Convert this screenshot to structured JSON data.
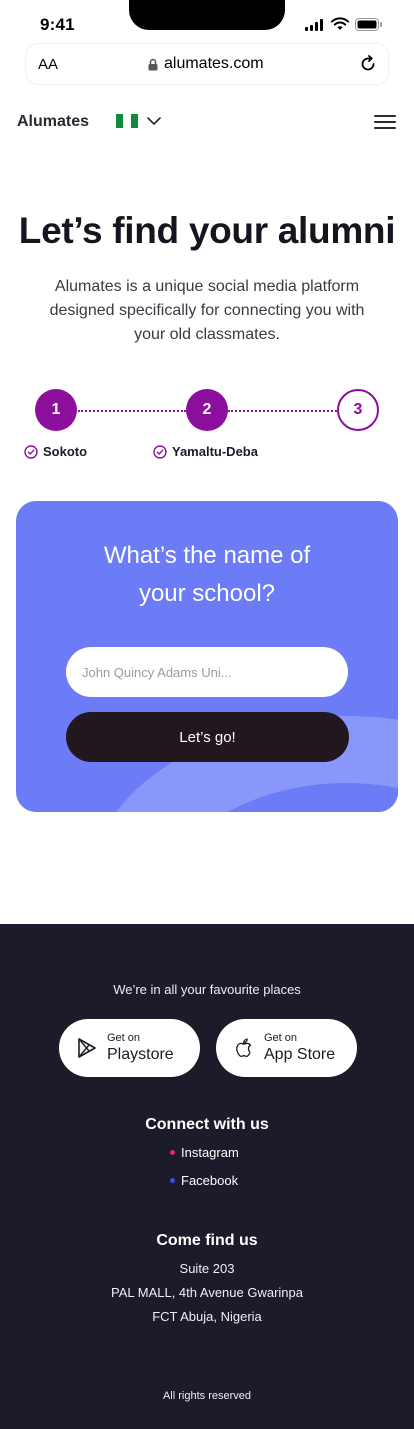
{
  "status_bar": {
    "time": "9:41"
  },
  "browser": {
    "text_size_label": "AA",
    "domain": "alumates.com"
  },
  "nav": {
    "brand": "Alumates"
  },
  "hero": {
    "title": "Let’s find your alumni",
    "subtitle": "Alumates is a unique social media platform designed specifically for connecting you with your old classmates."
  },
  "stepper": {
    "steps": [
      {
        "number": "1",
        "label": "Sokoto",
        "state": "complete"
      },
      {
        "number": "2",
        "label": "Yamaltu-Deba",
        "state": "complete"
      },
      {
        "number": "3",
        "label": "",
        "state": "current"
      }
    ],
    "accent": "#8b0f9c"
  },
  "card": {
    "question_line1": "What’s the name of",
    "question_line2": "your school?",
    "input_placeholder": "John Quincy Adams Uni...",
    "button_label": "Let’s go!",
    "background": "#6b7cf6"
  },
  "footer": {
    "tagline": "We’re in all your favourite places",
    "stores": [
      {
        "small": "Get on",
        "big": "Playstore",
        "icon": "play-store-icon"
      },
      {
        "small": "Get on",
        "big": "App Store",
        "icon": "apple-icon"
      }
    ],
    "connect_heading": "Connect with us",
    "social": [
      {
        "label": "Instagram",
        "dot_color": "#e0267d"
      },
      {
        "label": "Facebook",
        "dot_color": "#3b4fe0"
      }
    ],
    "find_heading": "Come find us",
    "address": [
      "Suite 203",
      "PAL MALL, 4th Avenue Gwarinpa",
      "FCT Abuja, Nigeria"
    ],
    "rights": "All rights reserved",
    "background": "#1b1b29"
  }
}
